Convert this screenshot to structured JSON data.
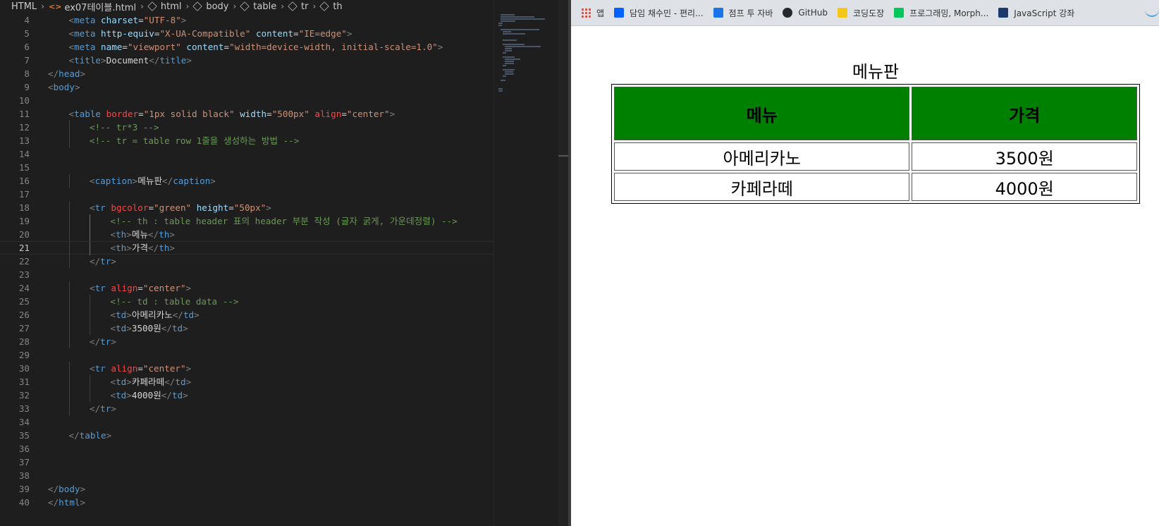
{
  "breadcrumb": [
    "HTML",
    "ex07테이블.html",
    "html",
    "body",
    "table",
    "tr",
    "th"
  ],
  "code_lines": [
    {
      "n": "4",
      "i": 1,
      "parts": [
        [
          "t",
          "<"
        ],
        [
          "tag",
          "meta"
        ],
        [
          "plain",
          " "
        ],
        [
          "attr",
          "charset"
        ],
        [
          "plain",
          "="
        ],
        [
          "val",
          "\"UTF-8\""
        ],
        [
          "t",
          ">"
        ]
      ]
    },
    {
      "n": "5",
      "i": 1,
      "parts": [
        [
          "t",
          "<"
        ],
        [
          "tag",
          "meta"
        ],
        [
          "plain",
          " "
        ],
        [
          "attr",
          "http-equiv"
        ],
        [
          "plain",
          "="
        ],
        [
          "val",
          "\"X-UA-Compatible\""
        ],
        [
          "plain",
          " "
        ],
        [
          "attr",
          "content"
        ],
        [
          "plain",
          "="
        ],
        [
          "val",
          "\"IE=edge\""
        ],
        [
          "t",
          ">"
        ]
      ]
    },
    {
      "n": "6",
      "i": 1,
      "parts": [
        [
          "t",
          "<"
        ],
        [
          "tag",
          "meta"
        ],
        [
          "plain",
          " "
        ],
        [
          "attr",
          "name"
        ],
        [
          "plain",
          "="
        ],
        [
          "val",
          "\"viewport\""
        ],
        [
          "plain",
          " "
        ],
        [
          "attr",
          "content"
        ],
        [
          "plain",
          "="
        ],
        [
          "val",
          "\"width=device-width, initial-scale=1.0\""
        ],
        [
          "t",
          ">"
        ]
      ]
    },
    {
      "n": "7",
      "i": 1,
      "parts": [
        [
          "t",
          "<"
        ],
        [
          "tag",
          "title"
        ],
        [
          "t",
          ">"
        ],
        [
          "plain",
          "Document"
        ],
        [
          "t",
          "</"
        ],
        [
          "tag",
          "title"
        ],
        [
          "t",
          ">"
        ]
      ]
    },
    {
      "n": "8",
      "i": 0,
      "parts": [
        [
          "t",
          "</"
        ],
        [
          "tag",
          "head"
        ],
        [
          "t",
          ">"
        ]
      ]
    },
    {
      "n": "9",
      "i": 0,
      "parts": [
        [
          "t",
          "<"
        ],
        [
          "tag",
          "body"
        ],
        [
          "t",
          ">"
        ]
      ]
    },
    {
      "n": "10",
      "i": 0,
      "parts": []
    },
    {
      "n": "11",
      "i": 1,
      "parts": [
        [
          "t",
          "<"
        ],
        [
          "tag",
          "table"
        ],
        [
          "plain",
          " "
        ],
        [
          "attr-r",
          "border"
        ],
        [
          "plain",
          "="
        ],
        [
          "val",
          "\"1px solid black\""
        ],
        [
          "plain",
          " "
        ],
        [
          "attr",
          "width"
        ],
        [
          "plain",
          "="
        ],
        [
          "val",
          "\"500px\""
        ],
        [
          "plain",
          " "
        ],
        [
          "attr-r",
          "align"
        ],
        [
          "plain",
          "="
        ],
        [
          "val",
          "\"center\""
        ],
        [
          "t",
          ">"
        ]
      ]
    },
    {
      "n": "12",
      "i": 2,
      "parts": [
        [
          "com",
          "<!-- tr*3 -->"
        ]
      ]
    },
    {
      "n": "13",
      "i": 2,
      "parts": [
        [
          "com",
          "<!-- tr = table row 1줄을 생성하는 방법 -->"
        ]
      ]
    },
    {
      "n": "14",
      "i": 0,
      "parts": []
    },
    {
      "n": "15",
      "i": 0,
      "parts": []
    },
    {
      "n": "16",
      "i": 2,
      "parts": [
        [
          "t",
          "<"
        ],
        [
          "tag",
          "caption"
        ],
        [
          "t",
          ">"
        ],
        [
          "plain",
          "메뉴판"
        ],
        [
          "t",
          "</"
        ],
        [
          "tag",
          "caption"
        ],
        [
          "t",
          ">"
        ]
      ]
    },
    {
      "n": "17",
      "i": 0,
      "parts": []
    },
    {
      "n": "18",
      "i": 2,
      "parts": [
        [
          "t",
          "<"
        ],
        [
          "tag",
          "tr"
        ],
        [
          "plain",
          " "
        ],
        [
          "attr-r",
          "bgcolor"
        ],
        [
          "plain",
          "="
        ],
        [
          "val",
          "\"green\""
        ],
        [
          "plain",
          " "
        ],
        [
          "attr",
          "height"
        ],
        [
          "plain",
          "="
        ],
        [
          "val",
          "\"50px\""
        ],
        [
          "t",
          ">"
        ]
      ]
    },
    {
      "n": "19",
      "i": 3,
      "parts": [
        [
          "com",
          "<!-- th : table header 표의 header 부분 작성 (글자 굵게, 가운데정렬) -->"
        ]
      ]
    },
    {
      "n": "20",
      "i": 3,
      "parts": [
        [
          "t",
          "<"
        ],
        [
          "tag",
          "th"
        ],
        [
          "t",
          ">"
        ],
        [
          "plain",
          "메뉴"
        ],
        [
          "t",
          "</"
        ],
        [
          "tag",
          "th"
        ],
        [
          "t",
          ">"
        ]
      ]
    },
    {
      "n": "21",
      "i": 3,
      "cur": true,
      "parts": [
        [
          "t",
          "<"
        ],
        [
          "tag",
          "th"
        ],
        [
          "t",
          ">"
        ],
        [
          "plain",
          "가격"
        ],
        [
          "t",
          "</"
        ],
        [
          "tag",
          "th"
        ],
        [
          "t",
          ">"
        ]
      ]
    },
    {
      "n": "22",
      "i": 2,
      "parts": [
        [
          "t",
          "</"
        ],
        [
          "tag",
          "tr"
        ],
        [
          "t",
          ">"
        ]
      ]
    },
    {
      "n": "23",
      "i": 0,
      "parts": []
    },
    {
      "n": "24",
      "i": 2,
      "parts": [
        [
          "t",
          "<"
        ],
        [
          "tag",
          "tr"
        ],
        [
          "plain",
          " "
        ],
        [
          "attr-r",
          "align"
        ],
        [
          "plain",
          "="
        ],
        [
          "val",
          "\"center\""
        ],
        [
          "t",
          ">"
        ]
      ]
    },
    {
      "n": "25",
      "i": 3,
      "parts": [
        [
          "com",
          "<!-- td : table data -->"
        ]
      ]
    },
    {
      "n": "26",
      "i": 3,
      "parts": [
        [
          "t",
          "<"
        ],
        [
          "tag",
          "td"
        ],
        [
          "t",
          ">"
        ],
        [
          "plain",
          "아메리카노"
        ],
        [
          "t",
          "</"
        ],
        [
          "tag",
          "td"
        ],
        [
          "t",
          ">"
        ]
      ]
    },
    {
      "n": "27",
      "i": 3,
      "parts": [
        [
          "t",
          "<"
        ],
        [
          "tag",
          "td"
        ],
        [
          "t",
          ">"
        ],
        [
          "plain",
          "3500원"
        ],
        [
          "t",
          "</"
        ],
        [
          "tag",
          "td"
        ],
        [
          "t",
          ">"
        ]
      ]
    },
    {
      "n": "28",
      "i": 2,
      "parts": [
        [
          "t",
          "</"
        ],
        [
          "tag",
          "tr"
        ],
        [
          "t",
          ">"
        ]
      ]
    },
    {
      "n": "29",
      "i": 0,
      "parts": []
    },
    {
      "n": "30",
      "i": 2,
      "parts": [
        [
          "t",
          "<"
        ],
        [
          "tag",
          "tr"
        ],
        [
          "plain",
          " "
        ],
        [
          "attr-r",
          "align"
        ],
        [
          "plain",
          "="
        ],
        [
          "val",
          "\"center\""
        ],
        [
          "t",
          ">"
        ]
      ]
    },
    {
      "n": "31",
      "i": 3,
      "parts": [
        [
          "t",
          "<"
        ],
        [
          "tag",
          "td"
        ],
        [
          "t",
          ">"
        ],
        [
          "plain",
          "카페라떼"
        ],
        [
          "t",
          "</"
        ],
        [
          "tag",
          "td"
        ],
        [
          "t",
          ">"
        ]
      ]
    },
    {
      "n": "32",
      "i": 3,
      "parts": [
        [
          "t",
          "<"
        ],
        [
          "tag",
          "td"
        ],
        [
          "t",
          ">"
        ],
        [
          "plain",
          "4000원"
        ],
        [
          "t",
          "</"
        ],
        [
          "tag",
          "td"
        ],
        [
          "t",
          ">"
        ]
      ]
    },
    {
      "n": "33",
      "i": 2,
      "parts": [
        [
          "t",
          "</"
        ],
        [
          "tag",
          "tr"
        ],
        [
          "t",
          ">"
        ]
      ]
    },
    {
      "n": "34",
      "i": 0,
      "parts": []
    },
    {
      "n": "35",
      "i": 1,
      "parts": [
        [
          "t",
          "</"
        ],
        [
          "tag",
          "table"
        ],
        [
          "t",
          ">"
        ]
      ]
    },
    {
      "n": "36",
      "i": 0,
      "parts": []
    },
    {
      "n": "37",
      "i": 0,
      "parts": []
    },
    {
      "n": "38",
      "i": 0,
      "parts": []
    },
    {
      "n": "39",
      "i": 0,
      "parts": [
        [
          "t",
          "</"
        ],
        [
          "tag",
          "body"
        ],
        [
          "t",
          ">"
        ]
      ]
    },
    {
      "n": "40",
      "i": 0,
      "parts": [
        [
          "t",
          "</"
        ],
        [
          "tag",
          "html"
        ],
        [
          "t",
          ">"
        ]
      ]
    }
  ],
  "bookmarks": [
    {
      "label": "앱",
      "icon": "apps-grid-icon",
      "color": "#ea4335"
    },
    {
      "label": "담임 채수민 - 편리...",
      "icon": "dropbox-icon",
      "color": "#0061fe"
    },
    {
      "label": "점프 투 자바",
      "icon": "book-icon",
      "color": "#1a73e8"
    },
    {
      "label": "GitHub",
      "icon": "github-icon",
      "color": "#24292e"
    },
    {
      "label": "코딩도장",
      "icon": "codingdojang-icon",
      "color": "#f5c518"
    },
    {
      "label": "프로그래밍, Morph...",
      "icon": "blog-icon",
      "color": "#03c75a"
    },
    {
      "label": "JavaScript 강좌",
      "icon": "chart-icon",
      "color": "#1a3a6b"
    }
  ],
  "rendered_table": {
    "caption": "메뉴판",
    "headers": [
      "메뉴",
      "가격"
    ],
    "header_bg": "#008000",
    "rows": [
      [
        "아메리카노",
        "3500원"
      ],
      [
        "카페라떼",
        "4000원"
      ]
    ]
  }
}
